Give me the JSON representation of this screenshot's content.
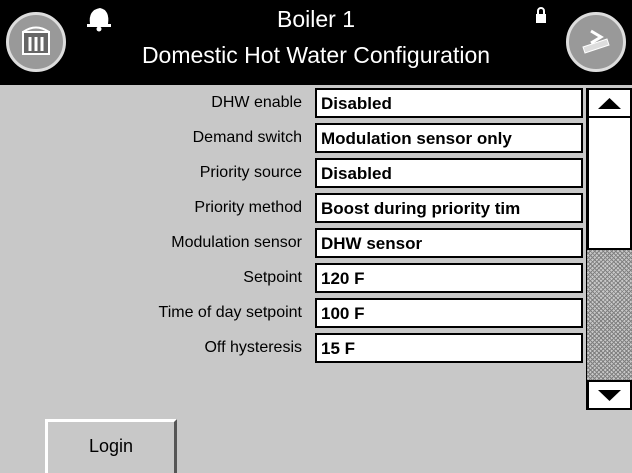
{
  "header": {
    "title_line1": "Boiler 1",
    "title_line2": "Domestic Hot Water Configuration",
    "home_icon": "home-icon",
    "back_icon": "back-icon",
    "bell_icon": "bell-icon",
    "lock_icon": "lock-icon"
  },
  "settings": [
    {
      "label": "DHW enable",
      "value": "Disabled"
    },
    {
      "label": "Demand switch",
      "value": "Modulation sensor only"
    },
    {
      "label": "Priority source",
      "value": "Disabled"
    },
    {
      "label": "Priority method",
      "value": "Boost during priority tim"
    },
    {
      "label": "Modulation sensor",
      "value": "DHW sensor"
    },
    {
      "label": "Setpoint",
      "value": "120 F"
    },
    {
      "label": "Time of day setpoint",
      "value": "100 F"
    },
    {
      "label": "Off hysteresis",
      "value": "15 F"
    }
  ],
  "login": {
    "label": "Login"
  }
}
